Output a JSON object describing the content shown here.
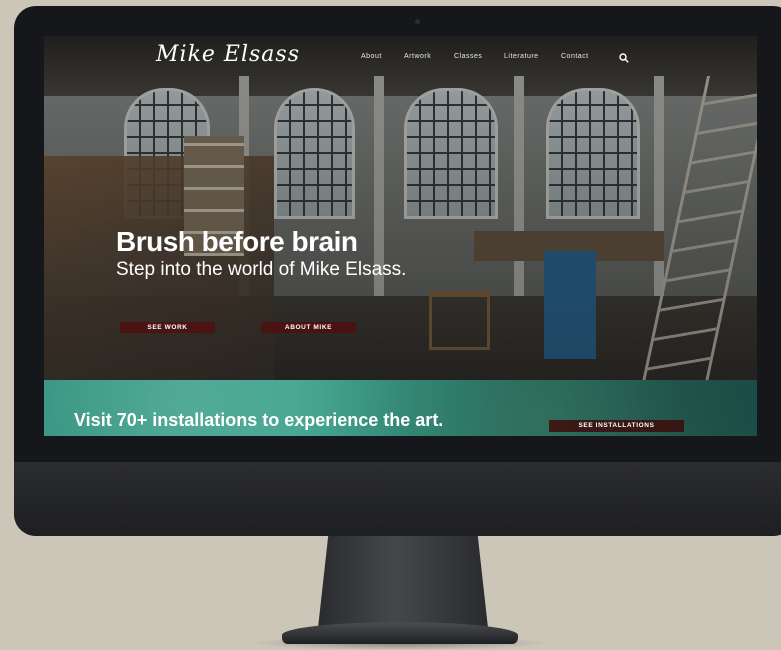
{
  "site": {
    "logo_text": "Mike Elsass",
    "nav": [
      "About",
      "Artwork",
      "Classes",
      "Literature",
      "Contact"
    ],
    "search_icon": "search-icon"
  },
  "hero": {
    "title": "Brush before brain",
    "subtitle": "Step into the world of Mike Elsass.",
    "buttons": [
      "SEE WORK",
      "ABOUT MIKE"
    ]
  },
  "band": {
    "text": "Visit 70+ installations to experience the art.",
    "button": "SEE INSTALLATIONS"
  },
  "colors": {
    "button_bg": "#500f0f",
    "band_teal": "#3aa28e"
  }
}
